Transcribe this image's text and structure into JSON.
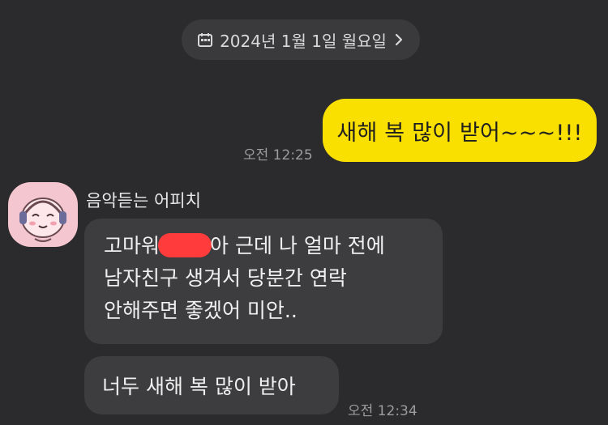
{
  "date_header": {
    "text": "2024년 1월 1일 월요일",
    "calendar_icon": "calendar-icon",
    "chevron_icon": "chevron-right-icon"
  },
  "messages": {
    "sent": {
      "text": "새해 복 많이 받어~~~!!!",
      "time": "오전 12:25"
    },
    "received": {
      "sender": "음악듣는 어피치",
      "avatar_icon": "apeach-avatar-icon",
      "line1_before": "고마워",
      "line1_after": "아 근데 나 얼마 전에",
      "line2": "남자친구 생겨서 당분간 연락",
      "line3": "안해주면 좋겠어 미안..",
      "second_text": "너두 새해 복 많이 받아",
      "time": "오전 12:34"
    }
  },
  "colors": {
    "background": "#2b2a2c",
    "sent_bubble": "#f9e000",
    "received_bubble": "#3d3d40",
    "redaction": "#ff3b3b"
  }
}
